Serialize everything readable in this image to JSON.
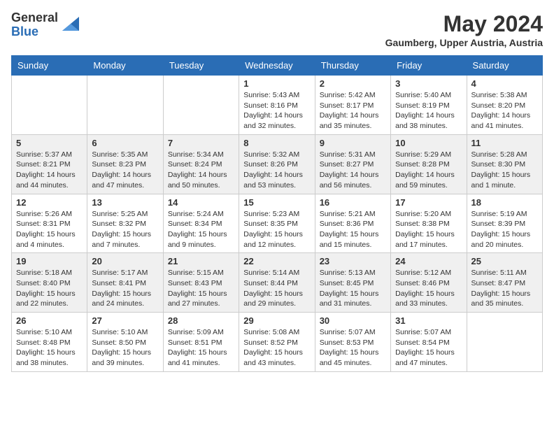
{
  "header": {
    "logo_general": "General",
    "logo_blue": "Blue",
    "month_year": "May 2024",
    "location": "Gaumberg, Upper Austria, Austria"
  },
  "days_of_week": [
    "Sunday",
    "Monday",
    "Tuesday",
    "Wednesday",
    "Thursday",
    "Friday",
    "Saturday"
  ],
  "weeks": [
    [
      {
        "day": "",
        "info": ""
      },
      {
        "day": "",
        "info": ""
      },
      {
        "day": "",
        "info": ""
      },
      {
        "day": "1",
        "info": "Sunrise: 5:43 AM\nSunset: 8:16 PM\nDaylight: 14 hours and 32 minutes."
      },
      {
        "day": "2",
        "info": "Sunrise: 5:42 AM\nSunset: 8:17 PM\nDaylight: 14 hours and 35 minutes."
      },
      {
        "day": "3",
        "info": "Sunrise: 5:40 AM\nSunset: 8:19 PM\nDaylight: 14 hours and 38 minutes."
      },
      {
        "day": "4",
        "info": "Sunrise: 5:38 AM\nSunset: 8:20 PM\nDaylight: 14 hours and 41 minutes."
      }
    ],
    [
      {
        "day": "5",
        "info": "Sunrise: 5:37 AM\nSunset: 8:21 PM\nDaylight: 14 hours and 44 minutes."
      },
      {
        "day": "6",
        "info": "Sunrise: 5:35 AM\nSunset: 8:23 PM\nDaylight: 14 hours and 47 minutes."
      },
      {
        "day": "7",
        "info": "Sunrise: 5:34 AM\nSunset: 8:24 PM\nDaylight: 14 hours and 50 minutes."
      },
      {
        "day": "8",
        "info": "Sunrise: 5:32 AM\nSunset: 8:26 PM\nDaylight: 14 hours and 53 minutes."
      },
      {
        "day": "9",
        "info": "Sunrise: 5:31 AM\nSunset: 8:27 PM\nDaylight: 14 hours and 56 minutes."
      },
      {
        "day": "10",
        "info": "Sunrise: 5:29 AM\nSunset: 8:28 PM\nDaylight: 14 hours and 59 minutes."
      },
      {
        "day": "11",
        "info": "Sunrise: 5:28 AM\nSunset: 8:30 PM\nDaylight: 15 hours and 1 minute."
      }
    ],
    [
      {
        "day": "12",
        "info": "Sunrise: 5:26 AM\nSunset: 8:31 PM\nDaylight: 15 hours and 4 minutes."
      },
      {
        "day": "13",
        "info": "Sunrise: 5:25 AM\nSunset: 8:32 PM\nDaylight: 15 hours and 7 minutes."
      },
      {
        "day": "14",
        "info": "Sunrise: 5:24 AM\nSunset: 8:34 PM\nDaylight: 15 hours and 9 minutes."
      },
      {
        "day": "15",
        "info": "Sunrise: 5:23 AM\nSunset: 8:35 PM\nDaylight: 15 hours and 12 minutes."
      },
      {
        "day": "16",
        "info": "Sunrise: 5:21 AM\nSunset: 8:36 PM\nDaylight: 15 hours and 15 minutes."
      },
      {
        "day": "17",
        "info": "Sunrise: 5:20 AM\nSunset: 8:38 PM\nDaylight: 15 hours and 17 minutes."
      },
      {
        "day": "18",
        "info": "Sunrise: 5:19 AM\nSunset: 8:39 PM\nDaylight: 15 hours and 20 minutes."
      }
    ],
    [
      {
        "day": "19",
        "info": "Sunrise: 5:18 AM\nSunset: 8:40 PM\nDaylight: 15 hours and 22 minutes."
      },
      {
        "day": "20",
        "info": "Sunrise: 5:17 AM\nSunset: 8:41 PM\nDaylight: 15 hours and 24 minutes."
      },
      {
        "day": "21",
        "info": "Sunrise: 5:15 AM\nSunset: 8:43 PM\nDaylight: 15 hours and 27 minutes."
      },
      {
        "day": "22",
        "info": "Sunrise: 5:14 AM\nSunset: 8:44 PM\nDaylight: 15 hours and 29 minutes."
      },
      {
        "day": "23",
        "info": "Sunrise: 5:13 AM\nSunset: 8:45 PM\nDaylight: 15 hours and 31 minutes."
      },
      {
        "day": "24",
        "info": "Sunrise: 5:12 AM\nSunset: 8:46 PM\nDaylight: 15 hours and 33 minutes."
      },
      {
        "day": "25",
        "info": "Sunrise: 5:11 AM\nSunset: 8:47 PM\nDaylight: 15 hours and 35 minutes."
      }
    ],
    [
      {
        "day": "26",
        "info": "Sunrise: 5:10 AM\nSunset: 8:48 PM\nDaylight: 15 hours and 38 minutes."
      },
      {
        "day": "27",
        "info": "Sunrise: 5:10 AM\nSunset: 8:50 PM\nDaylight: 15 hours and 39 minutes."
      },
      {
        "day": "28",
        "info": "Sunrise: 5:09 AM\nSunset: 8:51 PM\nDaylight: 15 hours and 41 minutes."
      },
      {
        "day": "29",
        "info": "Sunrise: 5:08 AM\nSunset: 8:52 PM\nDaylight: 15 hours and 43 minutes."
      },
      {
        "day": "30",
        "info": "Sunrise: 5:07 AM\nSunset: 8:53 PM\nDaylight: 15 hours and 45 minutes."
      },
      {
        "day": "31",
        "info": "Sunrise: 5:07 AM\nSunset: 8:54 PM\nDaylight: 15 hours and 47 minutes."
      },
      {
        "day": "",
        "info": ""
      }
    ]
  ]
}
